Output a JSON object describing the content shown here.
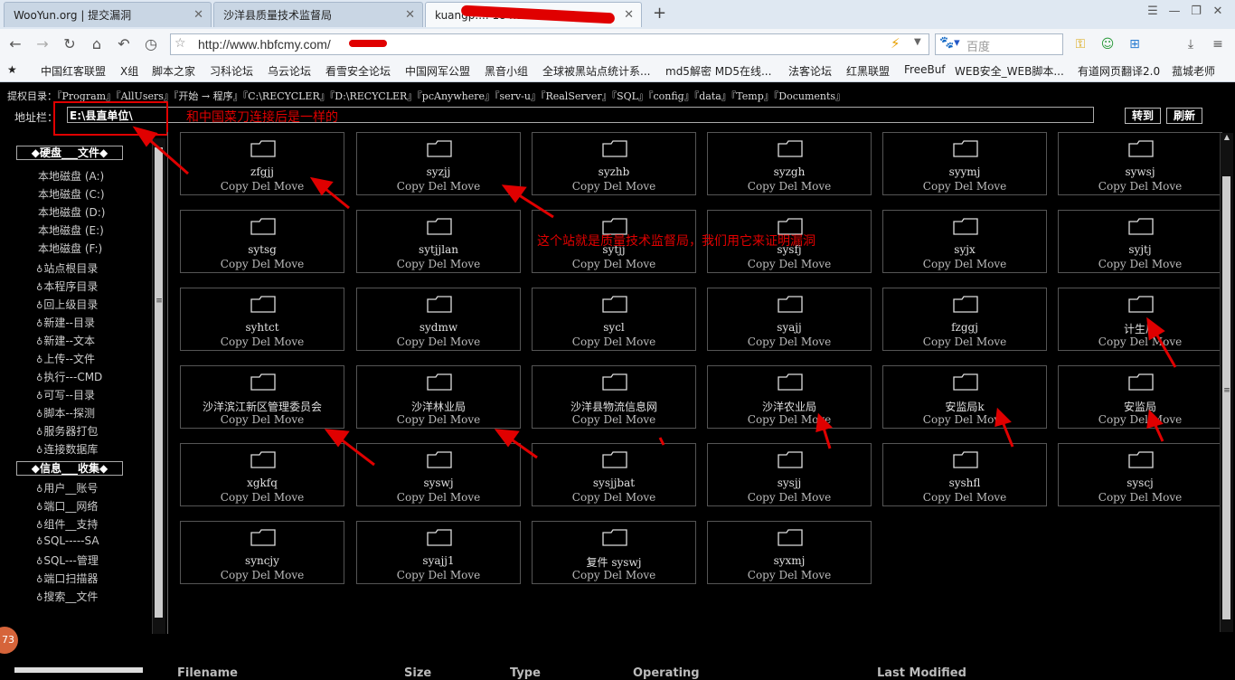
{
  "browser": {
    "tabs": [
      {
        "title": "WooYun.org | 提交漏洞"
      },
      {
        "title": "沙洋县质量技术监督局"
      },
      {
        "title": "kuangp.... 184.190.66"
      }
    ],
    "url": "http://www.hbfcmy.com/",
    "search_placeholder": "百度",
    "bookmarks": [
      "中国红客联盟",
      "X组",
      "脚本之家",
      "习科论坛",
      "乌云论坛",
      "看雪安全论坛",
      "中国网军公盟",
      "黑音小组",
      "全球被黑站点统计系...",
      "md5解密 MD5在线...",
      "法客论坛",
      "红黑联盟",
      "FreeBuf",
      "WEB安全_WEB脚本...",
      "有道网页翻译2.0",
      "菰城老师"
    ]
  },
  "shell": {
    "elevation_label": "提权目录：",
    "elevation_paths": "『Program』『AllUsers』『开始 → 程序』『C:\\RECYCLER』『D:\\RECYCLER』『pcAnywhere』『serv-u』『RealServer』『SQL』『config』『data』『Temp』『Documents』",
    "address_label": "地址栏：",
    "address_value": "E:\\县直单位\\",
    "goto_label": "转到",
    "refresh_label": "刷新"
  },
  "annotations": {
    "note1": "和中国菜刀连接后是一样的",
    "note2": "这个站就是质量技术监督局，我们用它来证明漏洞"
  },
  "sidebar": {
    "section1": "◆硬盘___文件◆",
    "drives": [
      "本地磁盘 (A:)",
      "本地磁盘 (C:)",
      "本地磁盘 (D:)",
      "本地磁盘 (E:)",
      "本地磁盘 (F:)"
    ],
    "functions": [
      "站点根目录",
      "本程序目录",
      "回上级目录",
      "新建--目录",
      "新建--文本",
      "上传--文件",
      "执行---CMD",
      "可写--目录",
      "脚本--探测",
      "服务器打包",
      "连接数据库"
    ],
    "section2": "◆信息___收集◆",
    "info": [
      "用户__账号",
      "端口__网络",
      "组件__支持",
      "SQL-----SA",
      "SQL---管理",
      "端口扫描器",
      "搜索__文件"
    ],
    "badge": "73"
  },
  "folders": [
    {
      "name": "zfgjj"
    },
    {
      "name": "syzjj"
    },
    {
      "name": "syzhb"
    },
    {
      "name": "syzgh"
    },
    {
      "name": "syymj"
    },
    {
      "name": "sywsj"
    },
    {
      "name": "sytsg"
    },
    {
      "name": "sytjjlan"
    },
    {
      "name": "sytjj"
    },
    {
      "name": "sysfj"
    },
    {
      "name": "syjx"
    },
    {
      "name": "syjtj"
    },
    {
      "name": "syhtct"
    },
    {
      "name": "sydmw"
    },
    {
      "name": "sycl"
    },
    {
      "name": "syajj"
    },
    {
      "name": "fzggj"
    },
    {
      "name": "计生局"
    },
    {
      "name": "沙洋滨江新区管理委员会"
    },
    {
      "name": "沙洋林业局"
    },
    {
      "name": "沙洋县物流信息网"
    },
    {
      "name": "沙洋农业局"
    },
    {
      "name": "安监局k"
    },
    {
      "name": "安监局"
    },
    {
      "name": "xgkfq"
    },
    {
      "name": "syswj"
    },
    {
      "name": "sysjjbat"
    },
    {
      "name": "sysjj"
    },
    {
      "name": "syshfl"
    },
    {
      "name": "syscj"
    },
    {
      "name": "syncjy"
    },
    {
      "name": "syajj1"
    },
    {
      "name": "复件 syswj"
    },
    {
      "name": "syxmj"
    }
  ],
  "folder_ops": "Copy Del Move",
  "table_headers": [
    "Filename",
    "Size",
    "Type",
    "Operating",
    "Last Modified"
  ],
  "colors": {
    "annotation_red": "#e00000",
    "background": "#000000"
  }
}
